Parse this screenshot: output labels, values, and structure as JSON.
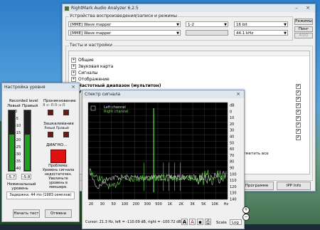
{
  "main_window": {
    "title": "RightMark Audio Analyzer 6.2.5",
    "devices_group": "Устройства воспроизведения/записи и режимы",
    "playback_device": "[MME] Wave mapper",
    "record_device": "[MME] Wave mapper",
    "channels": "1-2",
    "bits": "16 bit",
    "rate": "44.1 kHz",
    "right_buttons": [
      "Режимы",
      "Пинг",
      "ASIO"
    ],
    "tests_group": "Тесты и настройки",
    "tree_items": [
      {
        "label": "Общие",
        "bold": false,
        "checked": null
      },
      {
        "label": "Звуковая карта",
        "bold": false,
        "checked": null
      },
      {
        "label": "Сигналы",
        "bold": false,
        "checked": null
      },
      {
        "label": "Отображение",
        "bold": false,
        "checked": null
      },
      {
        "label": "Частотный диапазон (мультитон)",
        "bold": true,
        "checked": true
      },
      {
        "label": "Уровень шума",
        "bold": true,
        "checked": true
      }
    ],
    "extra_checks": 7,
    "select_all": "Отметить все",
    "bottom_buttons": [
      "Программе",
      "IPP Info"
    ]
  },
  "levels_window": {
    "title": "Настройка уровня",
    "recorded_label": "Recorded level",
    "left_label": "Левый",
    "right_label": "Правый",
    "scale": [
      "0",
      "-5",
      "-10",
      "-15",
      "-20",
      "-25",
      "-30",
      "-35",
      "-40"
    ],
    "left_value": "-5.7",
    "right_value": "-5.8",
    "left_level": 0.6,
    "right_level": 0.6,
    "nominal_label": "Номинальный уровень",
    "leak_label": "Проникновение",
    "leak_dirs": "Л <- П    Л -> П",
    "clip_label": "Зашкаливание",
    "clip_dirs": "Левый    Правый",
    "diag_label": "ДИАГНО...",
    "problem_text": "Проблема: Уровень сигнала недостаточен. Увеличьте уровень в микшере.",
    "latency": "Задержка: 44 ms (1983 семплов)",
    "start_button": "Начать тест",
    "cancel_button": "Отмена"
  },
  "spectrum_window": {
    "title": "Спектр сигнала",
    "legend": [
      "Left channel",
      "Right channel"
    ],
    "x_ticks": [
      "20",
      "30",
      "50",
      "100",
      "200",
      "300",
      "500",
      "1K",
      "2K",
      "3K",
      "5K",
      "10K",
      "Hz"
    ],
    "y_ticks": [
      "dB",
      "0",
      "10",
      "20",
      "30",
      "40",
      "50",
      "60",
      "70",
      "80",
      "90",
      "100",
      "110",
      "120",
      "130",
      "140"
    ],
    "status": "Cursor:  21.3 Hz, left = -110.09 dB, right = -100.72 dB",
    "scale_label": "Scale",
    "scale_value": "Log",
    "tool_icons": [
      "A",
      "font-icon",
      "save-icon",
      "print-icon"
    ],
    "colors": {
      "left": "#d8d8d8",
      "right": "#66e04a"
    }
  }
}
